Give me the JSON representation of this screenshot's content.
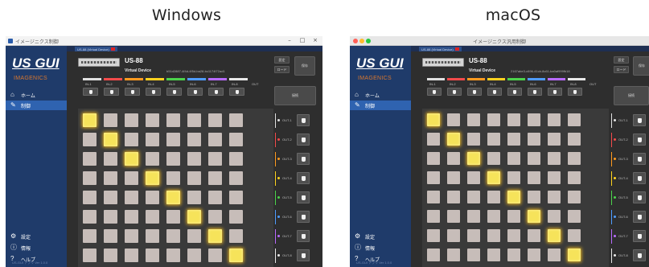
{
  "headings": {
    "windows": "Windows",
    "macos": "macOS"
  },
  "app": {
    "logo_main": "US GUI",
    "logo_sub": "IMAGENICS",
    "window_title_win": "イメージニクス制御",
    "window_title_mac": "イメージニクス汎用制御",
    "footer_text": "US-GUI アプリ Ver 1.0.0",
    "tab_label": "US-88 (Virtual Device)",
    "device_name": "US-88",
    "device_type": "Virtual Device",
    "device_serial_win": "b51d2887-4f4d-4f5d-ba28-bc1174f72ad1",
    "device_serial_mac": "2167abe3-c696-41cb-8c61-ba0af999fb18",
    "buttons": {
      "settings": "設定",
      "load": "ロード",
      "save": "保存",
      "connect": "接続"
    },
    "nav": [
      {
        "label": "ホーム",
        "icon": "home-icon"
      },
      {
        "label": "制御",
        "icon": "pencil-icon"
      }
    ],
    "bottom_nav": [
      {
        "label": "設定",
        "icon": "gear-icon"
      },
      {
        "label": "情報",
        "icon": "info-icon"
      },
      {
        "label": "ヘルプ",
        "icon": "help-icon"
      }
    ],
    "inputs": [
      "IN-1",
      "IN-2",
      "IN-3",
      "IN-4",
      "IN-5",
      "IN-6",
      "IN-7",
      "IN-8"
    ],
    "outputs": [
      "OUT-1",
      "OUT-2",
      "OUT-3",
      "OUT-4",
      "OUT-5",
      "OUT-6",
      "OUT-7",
      "OUT-8"
    ],
    "out_label": "OUT",
    "colors": {
      "sidebar": "#1f3b6a",
      "logo_sub": "#d9772e",
      "active_nav": "#2f63b0",
      "cell_off": "#c7bdb9",
      "cell_on": "#f6e35a",
      "channel_colors": [
        "#e0e0e0",
        "#f44b4b",
        "#ff9a1f",
        "#ffd21f",
        "#4cd34c",
        "#4f9cff",
        "#b86bff",
        "#e8e8e8"
      ]
    },
    "routing_on_diagonal": true
  }
}
